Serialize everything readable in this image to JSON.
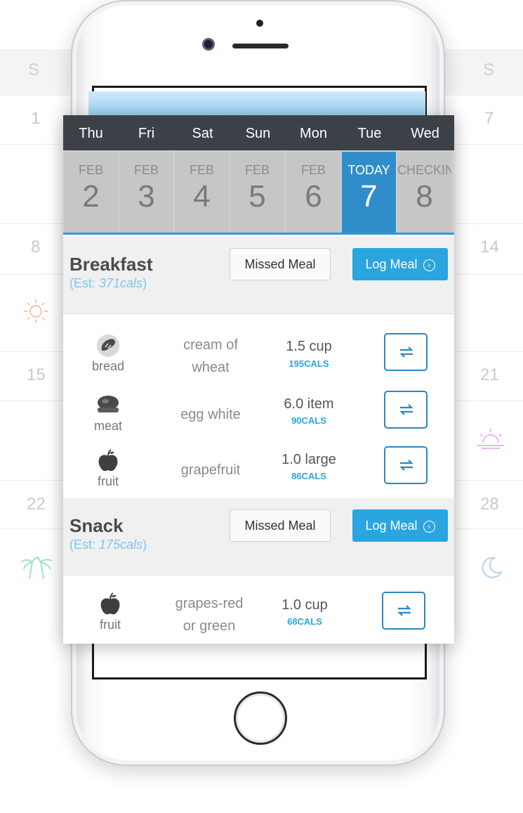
{
  "background": {
    "weekday_left": "S",
    "weekday_right": "S",
    "left_dates": [
      "1",
      "8",
      "15",
      "22"
    ],
    "right_dates": [
      "7",
      "14",
      "21",
      "28"
    ]
  },
  "weekdays": [
    "Thu",
    "Fri",
    "Sat",
    "Sun",
    "Mon",
    "Tue",
    "Wed"
  ],
  "dates": [
    {
      "month": "FEB",
      "day": "2"
    },
    {
      "month": "FEB",
      "day": "3"
    },
    {
      "month": "FEB",
      "day": "4"
    },
    {
      "month": "FEB",
      "day": "5"
    },
    {
      "month": "FEB",
      "day": "6"
    },
    {
      "month": "TODAY",
      "day": "7"
    },
    {
      "month": "CHECKIN",
      "day": "8"
    }
  ],
  "breakfast": {
    "title": "Breakfast",
    "est_prefix": "(Est: ",
    "est_value": "371cals",
    "est_suffix": ")",
    "missed_label": "Missed Meal",
    "log_label": "Log Meal",
    "items": [
      {
        "category": "bread",
        "icon": "bread-icon",
        "name_line1": "cream of",
        "name_line2": "wheat",
        "qty": "1.5 cup",
        "cals": "195CALS"
      },
      {
        "category": "meat",
        "icon": "meat-icon",
        "name_line1": "egg white",
        "name_line2": "",
        "qty": "6.0 item",
        "cals": "90CALS"
      },
      {
        "category": "fruit",
        "icon": "apple-icon",
        "name_line1": "grapefruit",
        "name_line2": "",
        "qty": "1.0 large",
        "cals": "86CALS"
      }
    ]
  },
  "snack": {
    "title": "Snack",
    "est_prefix": "(Est: ",
    "est_value": "175cals",
    "est_suffix": ")",
    "missed_label": "Missed Meal",
    "log_label": "Log Meal",
    "items": [
      {
        "category": "fruit",
        "icon": "apple-icon",
        "name_line1": "grapes-red",
        "name_line2": "or green",
        "qty": "1.0 cup",
        "cals": "68CALS"
      }
    ]
  },
  "colors": {
    "accent": "#2aa5e0",
    "today": "#2f8dc9",
    "weekday_bar": "#3b4147"
  }
}
